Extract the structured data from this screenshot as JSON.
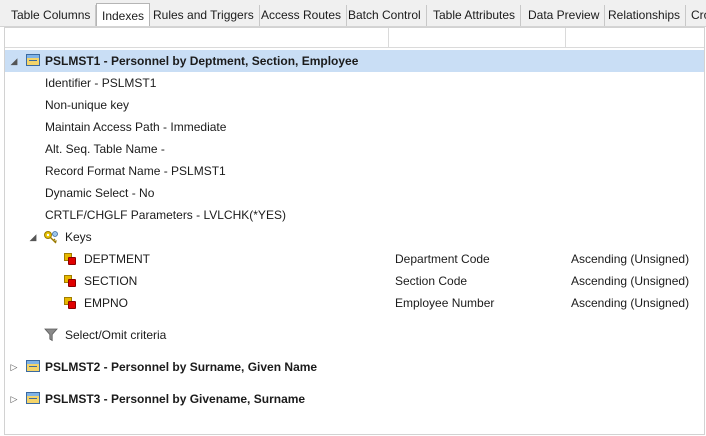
{
  "tabs": [
    {
      "label": "Table Columns",
      "active": false
    },
    {
      "label": "Indexes",
      "active": true
    },
    {
      "label": "Rules and Triggers",
      "active": false
    },
    {
      "label": "Access Routes",
      "active": false
    },
    {
      "label": "Batch Control",
      "active": false
    },
    {
      "label": "Table Attributes",
      "active": false
    },
    {
      "label": "Data Preview",
      "active": false
    },
    {
      "label": "Relationships",
      "active": false
    },
    {
      "label": "Cro",
      "active": false
    }
  ],
  "indexes": [
    {
      "title": "PSLMST1 - Personnel by Deptment, Section, Employee",
      "expanded": true,
      "selected": true,
      "properties": [
        "Identifier - PSLMST1",
        "Non-unique key",
        "Maintain Access Path - Immediate",
        "Alt. Seq. Table Name -",
        "Record Format Name - PSLMST1",
        "Dynamic Select - No",
        "CRTLF/CHGLF Parameters - LVLCHK(*YES)"
      ],
      "keys_label": "Keys",
      "keys": [
        {
          "field": "DEPTMENT",
          "description": "Department Code",
          "order": "Ascending (Unsigned)"
        },
        {
          "field": "SECTION",
          "description": "Section Code",
          "order": "Ascending (Unsigned)"
        },
        {
          "field": "EMPNO",
          "description": "Employee Number",
          "order": "Ascending (Unsigned)"
        }
      ],
      "select_omit_label": "Select/Omit criteria"
    },
    {
      "title": "PSLMST2 - Personnel by Surname, Given Name",
      "expanded": false
    },
    {
      "title": "PSLMST3 - Personnel by Givename, Surname",
      "expanded": false
    }
  ],
  "icons": {
    "index_node": "table-icon",
    "keys_node": "key-icon",
    "key_field": "field-icon",
    "select_omit": "filter-icon",
    "expanded": "triangle-down-icon",
    "collapsed": "triangle-right-icon"
  },
  "colors": {
    "selection": "#c9def5",
    "tab_bar": "#f0f0f0"
  }
}
